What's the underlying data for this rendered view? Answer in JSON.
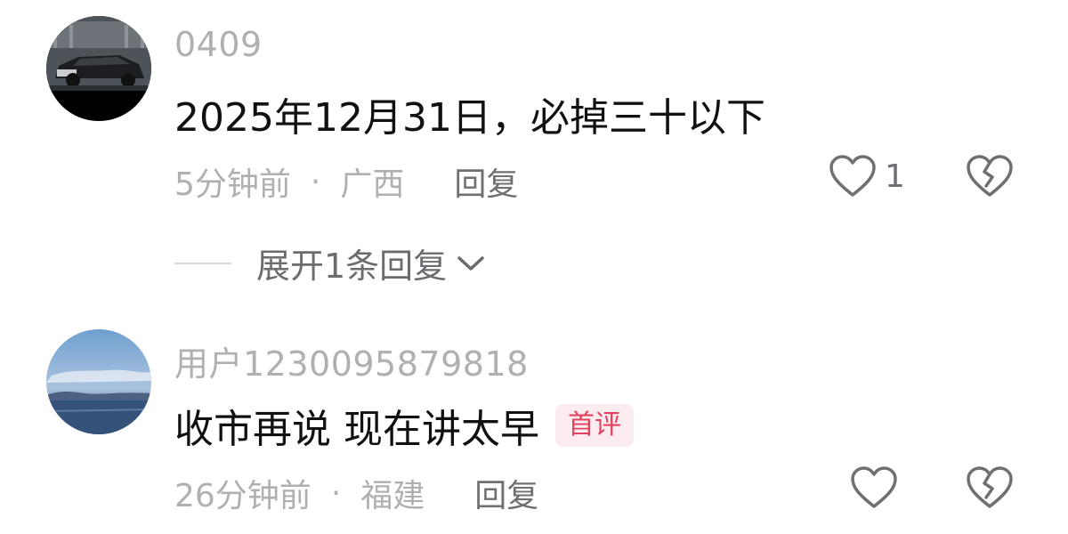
{
  "comments": [
    {
      "username": "0409",
      "avatar_icon": "car-photo-avatar",
      "text": "2025年12月31日，必掉三十以下",
      "time": "5分钟前",
      "separator": "·",
      "location": "广西",
      "reply_label": "回复",
      "like_count": "1",
      "expand_label": "展开1条回复"
    },
    {
      "username": "用户1230095879818",
      "avatar_icon": "landscape-photo-avatar",
      "text": "收市再说 现在讲太早",
      "badge": "首评",
      "time": "26分钟前",
      "separator": "·",
      "location": "福建",
      "reply_label": "回复"
    }
  ],
  "colors": {
    "badge_text": "#e0435f",
    "badge_bg": "#fdecef",
    "meta_text": "#b0b0b3"
  }
}
